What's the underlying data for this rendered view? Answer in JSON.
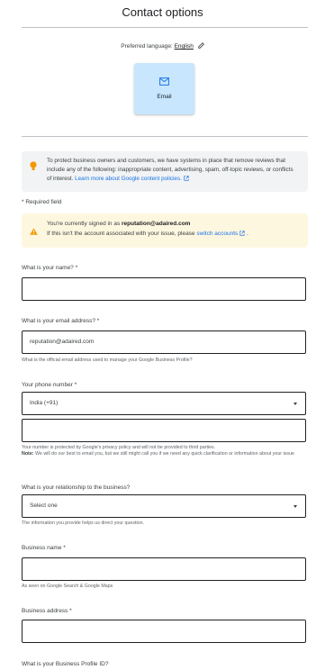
{
  "header": {
    "title": "Contact options"
  },
  "language": {
    "label": "Preferred language:",
    "value": "English"
  },
  "contact_option": {
    "label": "Email"
  },
  "info": {
    "text": "To protect business owners and customers, we have systems in place that remove reviews that include any of the following: inappropriate content, advertising, spam, off-topic reviews, or conflicts of interest.",
    "link": "Learn more about Google content policies."
  },
  "required_note": "* Required field",
  "warning": {
    "line1_prefix": "You're currently signed in as",
    "email": "reputation@adaired.com",
    "line2_prefix": "If this isn't the account associated with your issue, please",
    "link": "switch accounts",
    "line2_suffix": "."
  },
  "form": {
    "name": {
      "label": "What is your name? *",
      "value": ""
    },
    "email": {
      "label": "What is your email address? *",
      "value": "reputation@adaired.com",
      "help": "What is the official email address used to manage your Google Business Profile?"
    },
    "phone": {
      "label": "Your phone number *",
      "country": "India (+91)",
      "value": "",
      "help1": "Your number is protected by Google's privacy policy and will not be provided to third parties.",
      "help2_bold": "Note:",
      "help2": "We will do our best to email you, but we still might call you if we need any quick clarification or information about your issue"
    },
    "relationship": {
      "label": "What is your relationship to the business?",
      "value": "Select one",
      "help": "The information you provide helps us direct your question."
    },
    "business_name": {
      "label": "Business name *",
      "value": "",
      "help": "As seen on Google Search & Google Maps"
    },
    "business_address": {
      "label": "Business address *",
      "value": ""
    },
    "profile_id": {
      "label": "What is your Business Profile ID?"
    }
  }
}
